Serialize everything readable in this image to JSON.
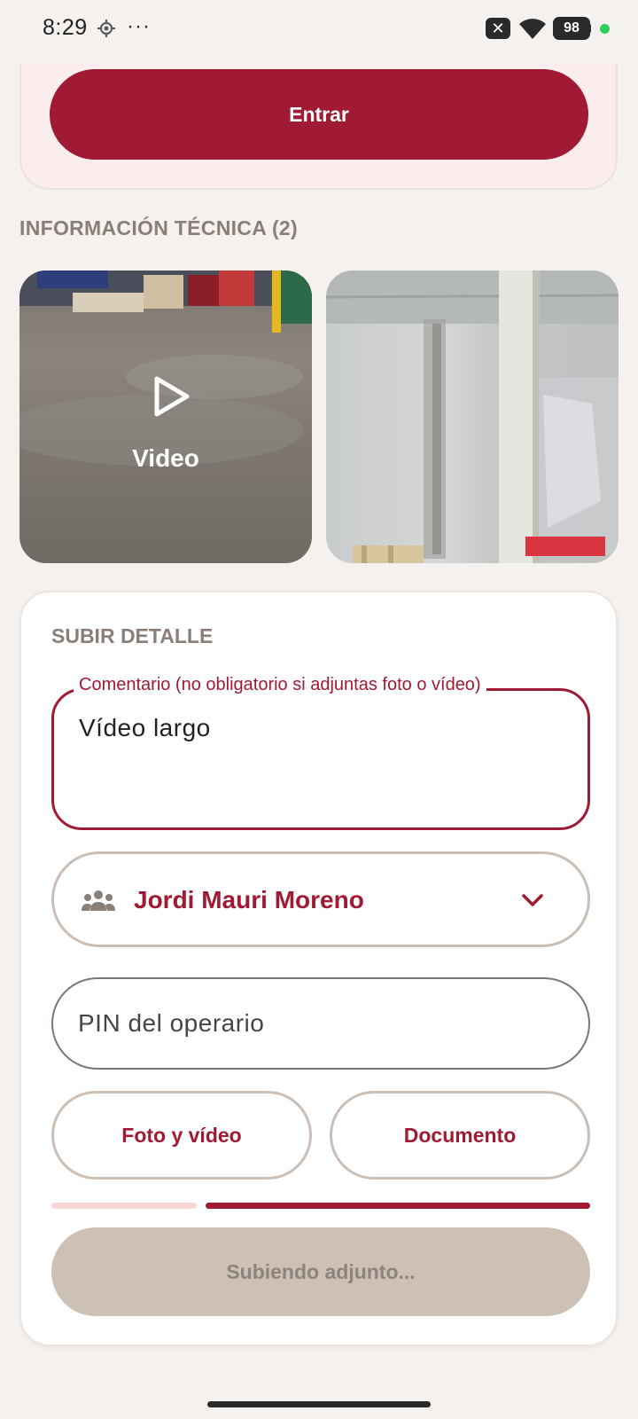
{
  "status_bar": {
    "time": "8:29",
    "dots": "···",
    "notif_x": "✕",
    "battery": "98"
  },
  "login": {
    "enter_label": "Entrar"
  },
  "technical_info": {
    "title": "INFORMACIÓN TÉCNICA (2)",
    "video_label": "Video"
  },
  "upload": {
    "title": "SUBIR DETALLE",
    "comment_label": "Comentario (no obligatorio si adjuntas foto o vídeo)",
    "comment_value": "Vídeo largo",
    "operator_name": "Jordi Mauri Moreno",
    "pin_placeholder": "PIN del operario",
    "photo_video_label": "Foto y vídeo",
    "document_label": "Documento",
    "uploading_label": "Subiendo adjunto..."
  },
  "icons": {
    "location": "location-icon",
    "wifi": "wifi-icon",
    "play": "play-icon",
    "people": "people-icon",
    "chevron": "chevron-down-icon"
  },
  "colors": {
    "accent": "#a11a33",
    "background": "#f5f1ee",
    "card_pink": "#fbeced",
    "border": "#cbbfb5",
    "disabled": "#cdc1b6"
  }
}
